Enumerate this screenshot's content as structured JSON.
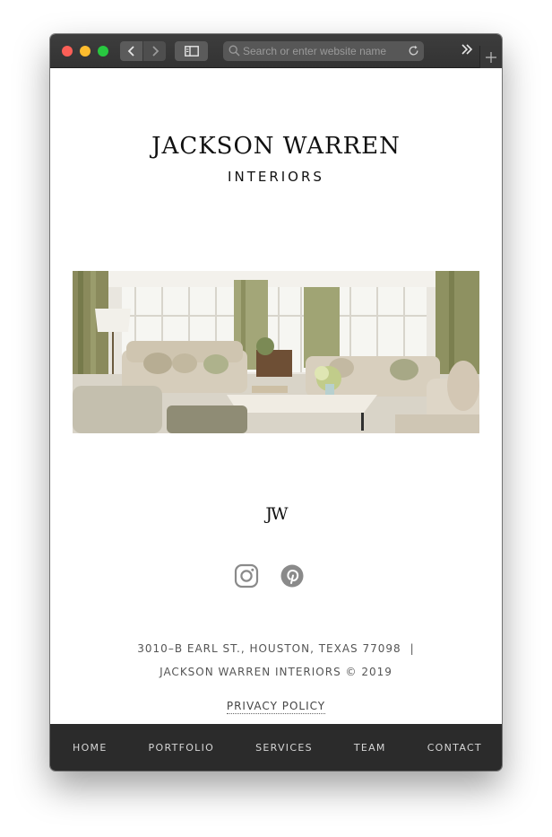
{
  "browser": {
    "search_placeholder": "Search or enter website name",
    "icons": [
      "back-icon",
      "forward-icon",
      "sidebar-icon",
      "search-icon",
      "reload-icon",
      "more-icon",
      "new-tab-icon"
    ]
  },
  "site": {
    "logo_main": "JACKSON WARREN",
    "logo_sub": "INTERIORS",
    "monogram": "JW",
    "social_icons": [
      "instagram-icon",
      "pinterest-icon"
    ],
    "address": "3010–B EARL ST., HOUSTON, TEXAS 77098",
    "address_separator": "|",
    "copyright": "JACKSON WARREN INTERIORS © 2019",
    "privacy": "PRIVACY POLICY"
  },
  "nav": {
    "items": [
      "HOME",
      "PORTFOLIO",
      "SERVICES",
      "TEAM",
      "CONTACT"
    ]
  },
  "colors": {
    "titlebar": "#333333",
    "footer": "#2b2b2b",
    "text": "#111111"
  }
}
